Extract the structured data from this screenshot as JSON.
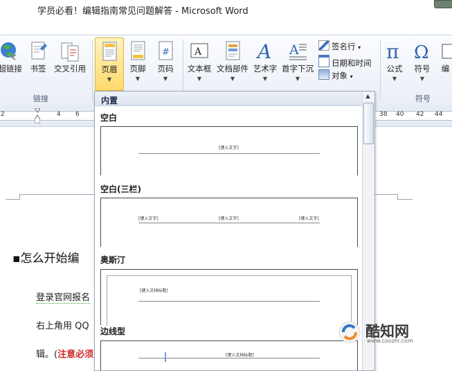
{
  "window": {
    "title": "学员必看！编辑指南常见问题解答  -  Microsoft Word"
  },
  "ribbon": {
    "buttons": {
      "hyperlink": "超链接",
      "bookmark": "书签",
      "cross_reference": "交叉引用",
      "header": "页眉",
      "footer": "页脚",
      "page_number": "页码",
      "text_box": "文本框",
      "quick_parts": "文档部件",
      "word_art": "艺术字",
      "drop_cap": "首字下沉",
      "equation": "公式",
      "symbol": "符号",
      "number": "编"
    },
    "small_items": {
      "signature_line": "签名行",
      "date_time": "日期和时间",
      "object": "对象"
    },
    "groups": {
      "links": "链接",
      "symbols": "符号"
    }
  },
  "ruler": {
    "left_ticks": [
      "2",
      "4",
      "6"
    ],
    "right_ticks": [
      "38",
      "40",
      "42",
      "44"
    ]
  },
  "document": {
    "heading": "▪怎么开始编",
    "line1": "登录官网报名",
    "line2": "右上角用 QQ",
    "line3_prefix": "辑。(",
    "line3_note": "注意必须"
  },
  "gallery": {
    "section": "内置",
    "items": [
      {
        "title": "空白",
        "labels": [
          "[键入文字]"
        ]
      },
      {
        "title": "空白(三栏)",
        "labels": [
          "[键入文字]",
          "[键入文字]",
          "[键入文字]"
        ]
      },
      {
        "title": "奥斯汀",
        "labels": [
          "[键入文档标题]"
        ]
      },
      {
        "title": "边线型",
        "labels": [
          "[键入文档标题]"
        ]
      }
    ]
  },
  "watermark": {
    "name": "酷知网",
    "url": "www.coozhi.com"
  },
  "colors": {
    "accent_header": "#ffd96b",
    "note_red": "#d12b2b",
    "ribbon_bg": "#e9eef6"
  }
}
